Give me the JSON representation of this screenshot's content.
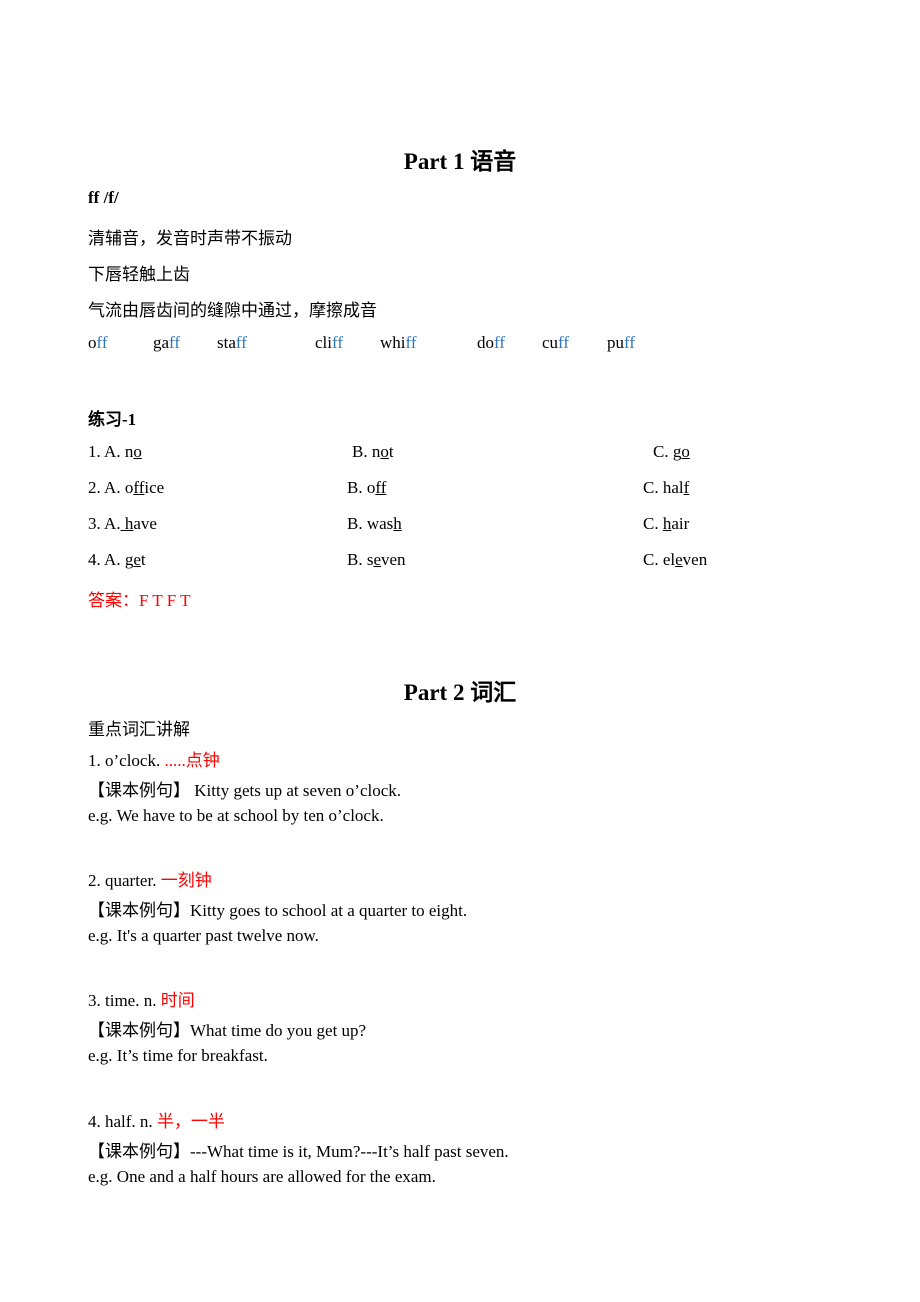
{
  "part1": {
    "title": "Part 1  语音",
    "phoneme": "ff /f/",
    "desc": [
      "清辅音，发音时声带不振动",
      "下唇轻触上齿",
      "气流由唇齿间的缝隙中通过，摩擦成音"
    ],
    "words": [
      {
        "pre": "o",
        "hl": "ff"
      },
      {
        "pre": "ga",
        "hl": "ff"
      },
      {
        "pre": "sta",
        "hl": "ff"
      },
      {
        "pre": "cli",
        "hl": "ff"
      },
      {
        "pre": "whi",
        "hl": "ff"
      },
      {
        "pre": "do",
        "hl": "ff"
      },
      {
        "pre": "cu",
        "hl": "ff"
      },
      {
        "pre": "pu",
        "hl": "ff"
      }
    ],
    "highlight_color": "#2e75b6"
  },
  "exercise": {
    "title": "练习-1",
    "rows": [
      {
        "a": [
          "1. A. n",
          "o",
          ""
        ],
        "b": [
          "B. n",
          "o",
          "t"
        ],
        "c": [
          "C. g",
          "o",
          ""
        ]
      },
      {
        "a": [
          "2. A. o",
          "ff",
          "ice"
        ],
        "b": [
          "B. o",
          "ff",
          ""
        ],
        "c": [
          "C. hal",
          "f ",
          ""
        ]
      },
      {
        "a": [
          "3. A.",
          " h",
          "ave"
        ],
        "b": [
          "B. was",
          "h",
          ""
        ],
        "c": [
          "C. ",
          "h",
          "air"
        ]
      },
      {
        "a": [
          "4. A. g",
          "e",
          "t"
        ],
        "b": [
          "B. s",
          "e",
          "ven"
        ],
        "c": [
          "C. el",
          "e",
          "ven"
        ]
      }
    ],
    "answer": "答案：F T F T",
    "answer_color": "#ff0000"
  },
  "part2": {
    "title": "Part 2  词汇",
    "subtitle": "重点词汇讲解",
    "entries": [
      {
        "head": "1. o’clock. ",
        "meaning": ".....点钟",
        "example": "【课本例句】  Kitty gets up at seven o’clock.",
        "eg": "e.g. We have to be at school by ten o’clock."
      },
      {
        "head": "2. quarter.  ",
        "meaning": "一刻钟",
        "example": "【课本例句】Kitty goes to school at a quarter to eight.",
        "eg": "e.g. It's a quarter past twelve now."
      },
      {
        "head": "3. time. n.  ",
        "meaning": "时间",
        "example": "【课本例句】What time do you get up?",
        "eg": "e.g. It’s time for breakfast."
      },
      {
        "head": "4. half. n.  ",
        "meaning": "半，一半",
        "example": "【课本例句】---What time is it, Mum?---It’s half past seven.",
        "eg": "e.g. One and a half hours are allowed for the exam."
      }
    ]
  }
}
